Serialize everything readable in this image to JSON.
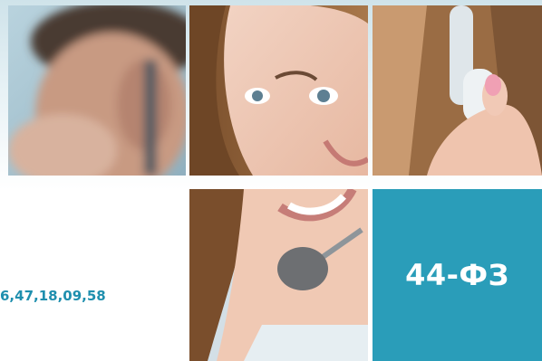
{
  "banner": {
    "law_label": "44-ФЗ",
    "category_codes": "6,47,18,09,58",
    "colors": {
      "accent": "#2a9db9",
      "codes_text": "#1f8fae",
      "background_top": "#cfe3ea"
    },
    "photo_tiles": [
      {
        "icon": "blurred-man-headset-photo"
      },
      {
        "icon": "smiling-woman-face-photo"
      },
      {
        "icon": "hand-on-headset-photo"
      },
      {
        "icon": "smile-microphone-photo"
      }
    ]
  }
}
